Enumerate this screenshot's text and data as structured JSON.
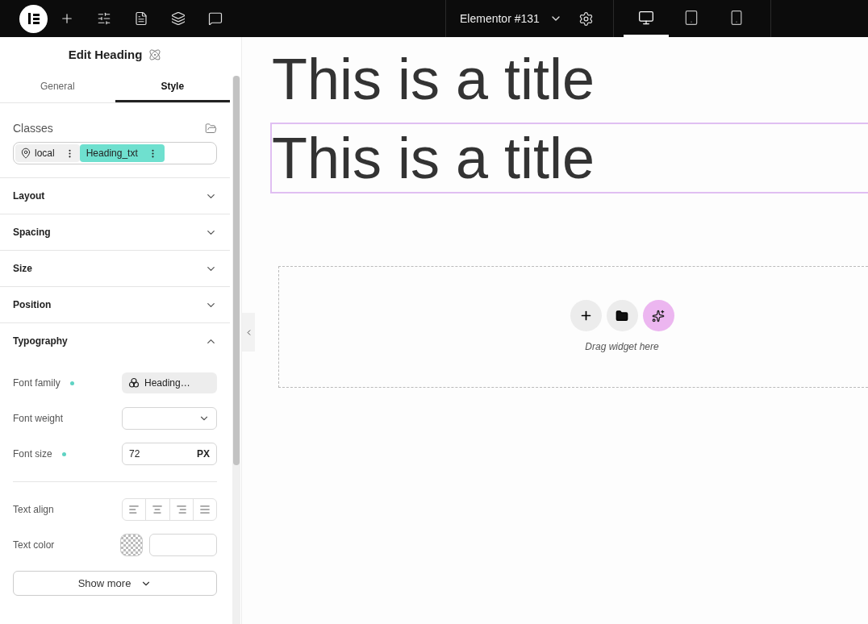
{
  "toolbar": {
    "page_title": "Elementor #131",
    "devices": [
      {
        "kind": "desktop",
        "selected": true
      },
      {
        "kind": "tablet",
        "selected": false
      },
      {
        "kind": "mobile",
        "selected": false
      }
    ]
  },
  "panel": {
    "title": "Edit Heading",
    "tabs": [
      {
        "label": "General",
        "selected": false
      },
      {
        "label": "Style",
        "selected": true
      }
    ],
    "classes": {
      "label": "Classes",
      "chips": [
        {
          "kind": "local",
          "label": "local"
        },
        {
          "kind": "class",
          "label": "Heading_txt"
        }
      ]
    },
    "sections": [
      {
        "label": "Layout",
        "expanded": false
      },
      {
        "label": "Spacing",
        "expanded": false
      },
      {
        "label": "Size",
        "expanded": false
      },
      {
        "label": "Position",
        "expanded": false
      },
      {
        "label": "Typography",
        "expanded": true
      }
    ],
    "typography": [
      {
        "kind": "font",
        "label": "Font family",
        "modified": true,
        "value": "Heading…"
      },
      {
        "kind": "select",
        "label": "Font weight",
        "modified": false
      },
      {
        "kind": "number",
        "label": "Font size",
        "modified": true,
        "value": "72",
        "unit": "PX"
      },
      {
        "kind": "divider"
      },
      {
        "kind": "align",
        "label": "Text align",
        "modified": false
      },
      {
        "kind": "color",
        "label": "Text color",
        "modified": false
      }
    ],
    "show_more": "Show more"
  },
  "canvas": {
    "headings": [
      {
        "text": "This is a title",
        "selected": false
      },
      {
        "text": "This is a title",
        "selected": true
      }
    ],
    "drop_zone": {
      "hint": "Drag widget here"
    }
  }
}
